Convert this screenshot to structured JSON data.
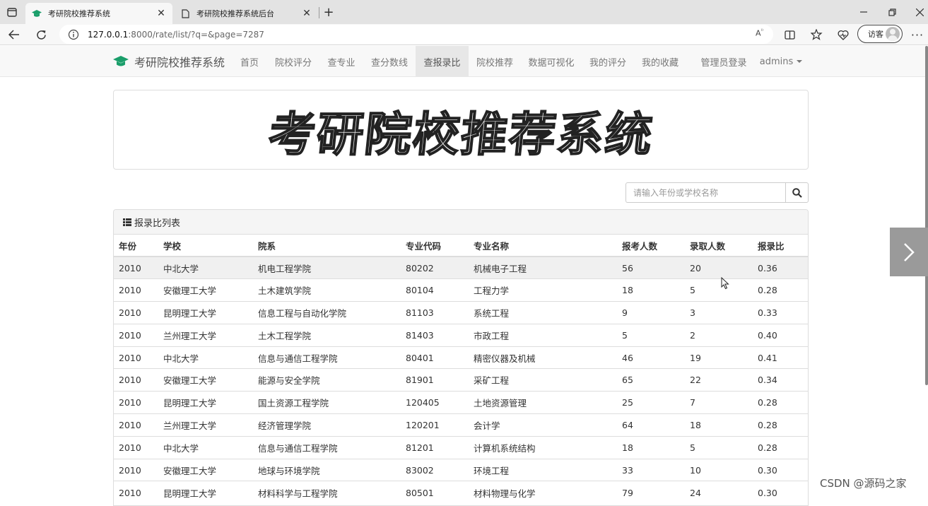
{
  "browser": {
    "tabs": [
      {
        "title": "考研院校推荐系统",
        "active": true
      },
      {
        "title": "考研院校推荐系统后台",
        "active": false
      }
    ],
    "url_host": "127.0.0.1",
    "url_path": ":8000/rate/list/?q=&page=7287",
    "profile_label": "访客"
  },
  "navbar": {
    "brand": "考研院校推荐系统",
    "items": [
      "首页",
      "院校评分",
      "查专业",
      "查分数线",
      "查报录比",
      "院校推荐",
      "数据可视化",
      "我的评分",
      "我的收藏",
      "管理员登录",
      "admins"
    ],
    "active_index": 4
  },
  "banner": {
    "title": "考研院校推荐系统"
  },
  "search": {
    "placeholder": "请输入年份或学校名称"
  },
  "panel": {
    "title": "报录比列表"
  },
  "table": {
    "columns": [
      "年份",
      "学校",
      "院系",
      "专业代码",
      "专业名称",
      "报考人数",
      "录取人数",
      "报录比"
    ],
    "rows": [
      [
        "2010",
        "中北大学",
        "机电工程学院",
        "80202",
        "机械电子工程",
        "56",
        "20",
        "0.36"
      ],
      [
        "2010",
        "安徽理工大学",
        "土木建筑学院",
        "80104",
        "工程力学",
        "18",
        "5",
        "0.28"
      ],
      [
        "2010",
        "昆明理工大学",
        "信息工程与自动化学院",
        "81103",
        "系统工程",
        "9",
        "3",
        "0.33"
      ],
      [
        "2010",
        "兰州理工大学",
        "土木工程学院",
        "81403",
        "市政工程",
        "5",
        "2",
        "0.40"
      ],
      [
        "2010",
        "中北大学",
        "信息与通信工程学院",
        "80401",
        "精密仪器及机械",
        "46",
        "19",
        "0.41"
      ],
      [
        "2010",
        "安徽理工大学",
        "能源与安全学院",
        "81901",
        "采矿工程",
        "65",
        "22",
        "0.34"
      ],
      [
        "2010",
        "昆明理工大学",
        "国土资源工程学院",
        "120405",
        "土地资源管理",
        "25",
        "7",
        "0.28"
      ],
      [
        "2010",
        "兰州理工大学",
        "经济管理学院",
        "120201",
        "会计学",
        "64",
        "18",
        "0.28"
      ],
      [
        "2010",
        "中北大学",
        "信息与通信工程学院",
        "81201",
        "计算机系统结构",
        "18",
        "5",
        "0.28"
      ],
      [
        "2010",
        "安徽理工大学",
        "地球与环境学院",
        "83002",
        "环境工程",
        "33",
        "10",
        "0.30"
      ],
      [
        "2010",
        "昆明理工大学",
        "材料科学与工程学院",
        "80501",
        "材料物理与化学",
        "79",
        "24",
        "0.30"
      ]
    ],
    "highlighted_row": 0
  },
  "watermark": "CSDN @源码之家"
}
